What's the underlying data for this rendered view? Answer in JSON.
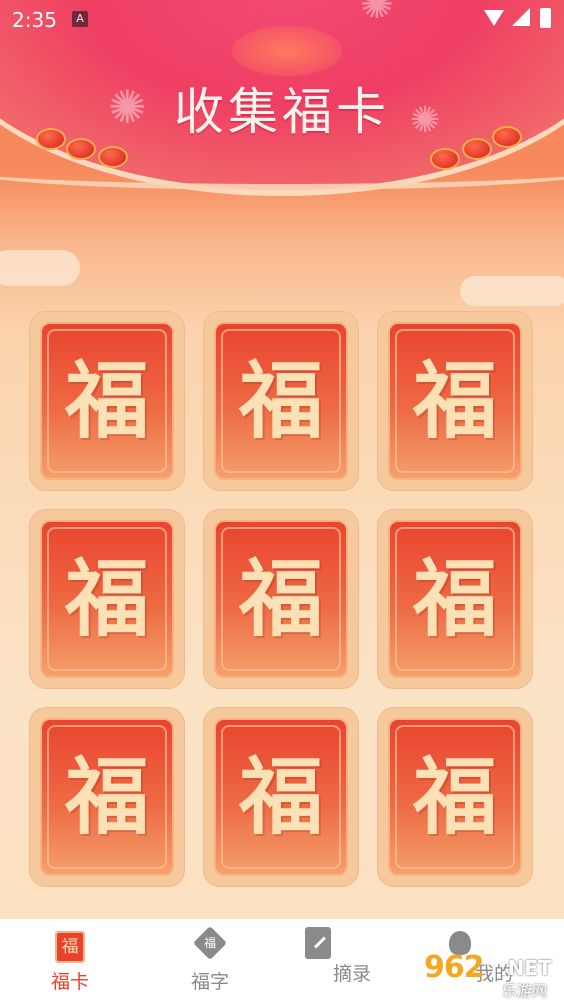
{
  "status_bar": {
    "time": "2:35",
    "notification_icon": "A"
  },
  "header": {
    "title": "收集福卡"
  },
  "cards": [
    {
      "char": "福"
    },
    {
      "char": "福"
    },
    {
      "char": "福"
    },
    {
      "char": "福"
    },
    {
      "char": "福"
    },
    {
      "char": "福"
    },
    {
      "char": "福"
    },
    {
      "char": "福"
    },
    {
      "char": "福"
    }
  ],
  "nav": {
    "items": [
      {
        "label": "福卡",
        "icon": "fu-card-icon",
        "icon_char": "福",
        "active": true
      },
      {
        "label": "福字",
        "icon": "fu-diamond-icon",
        "icon_char": "福",
        "active": false
      },
      {
        "label": "摘录",
        "icon": "notebook-icon",
        "active": false
      },
      {
        "label": "我的",
        "icon": "user-icon",
        "active": false
      }
    ]
  },
  "watermark": {
    "logo": "962",
    "net": ".NET",
    "subtitle": "乐游网"
  },
  "colors": {
    "active_nav": "#e8412c",
    "inactive_nav": "#8a8a8a",
    "card_red": "#e9442f",
    "fu_text": "#fde1b6"
  }
}
